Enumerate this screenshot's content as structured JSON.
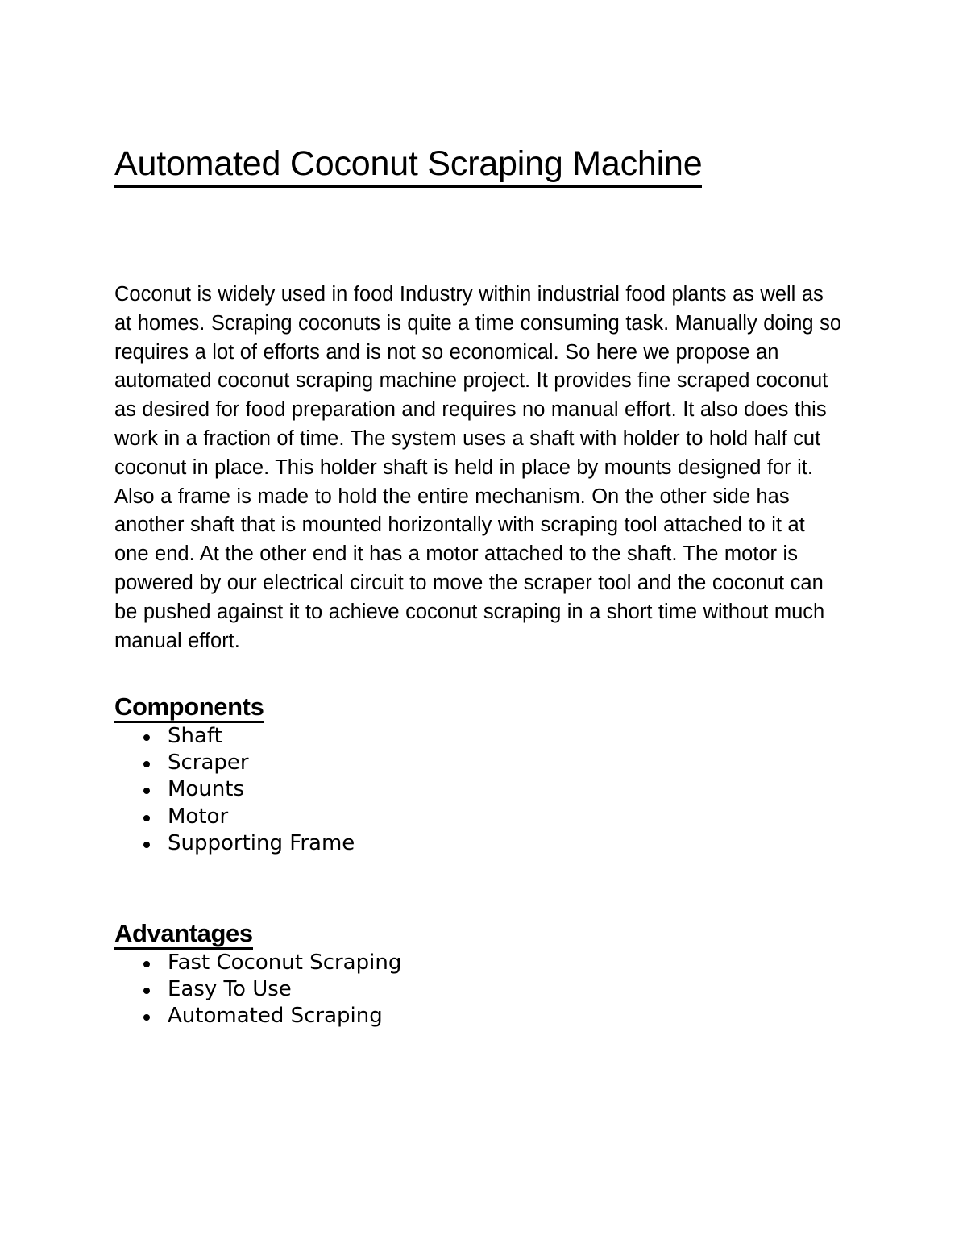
{
  "document": {
    "title": "Automated Coconut Scraping Machine",
    "background_color": "#ffffff",
    "text_color": "#000000",
    "paragraph": "Coconut is widely used in food Industry within industrial food plants as well as at homes. Scraping coconuts is quite a time consuming task. Manually doing so requires a lot of efforts and is not so economical. So here we propose an automated coconut scraping machine project. It provides fine scraped coconut as desired for food preparation and requires no manual effort. It also does this work in a fraction of time. The system uses a shaft with holder to hold half cut coconut in place. This holder shaft is held in place by mounts designed for it. Also a frame is made to hold the entire mechanism. On the other side has another shaft that is mounted horizontally with scraping tool attached to it at one end. At the other end it has a motor attached to the shaft. The motor is powered by our electrical circuit to move the scraper tool and the coconut can be pushed against it to achieve coconut scraping in a short time without much manual effort.",
    "sections": [
      {
        "heading": "Components",
        "items": [
          "Shaft",
          "Scraper",
          "Mounts",
          "Motor",
          "Supporting Frame"
        ]
      },
      {
        "heading": "Advantages",
        "items": [
          "Fast Coconut Scraping",
          "Easy To Use",
          "Automated Scraping"
        ]
      }
    ],
    "bullet_glyph": "bullet-dot-icon"
  }
}
